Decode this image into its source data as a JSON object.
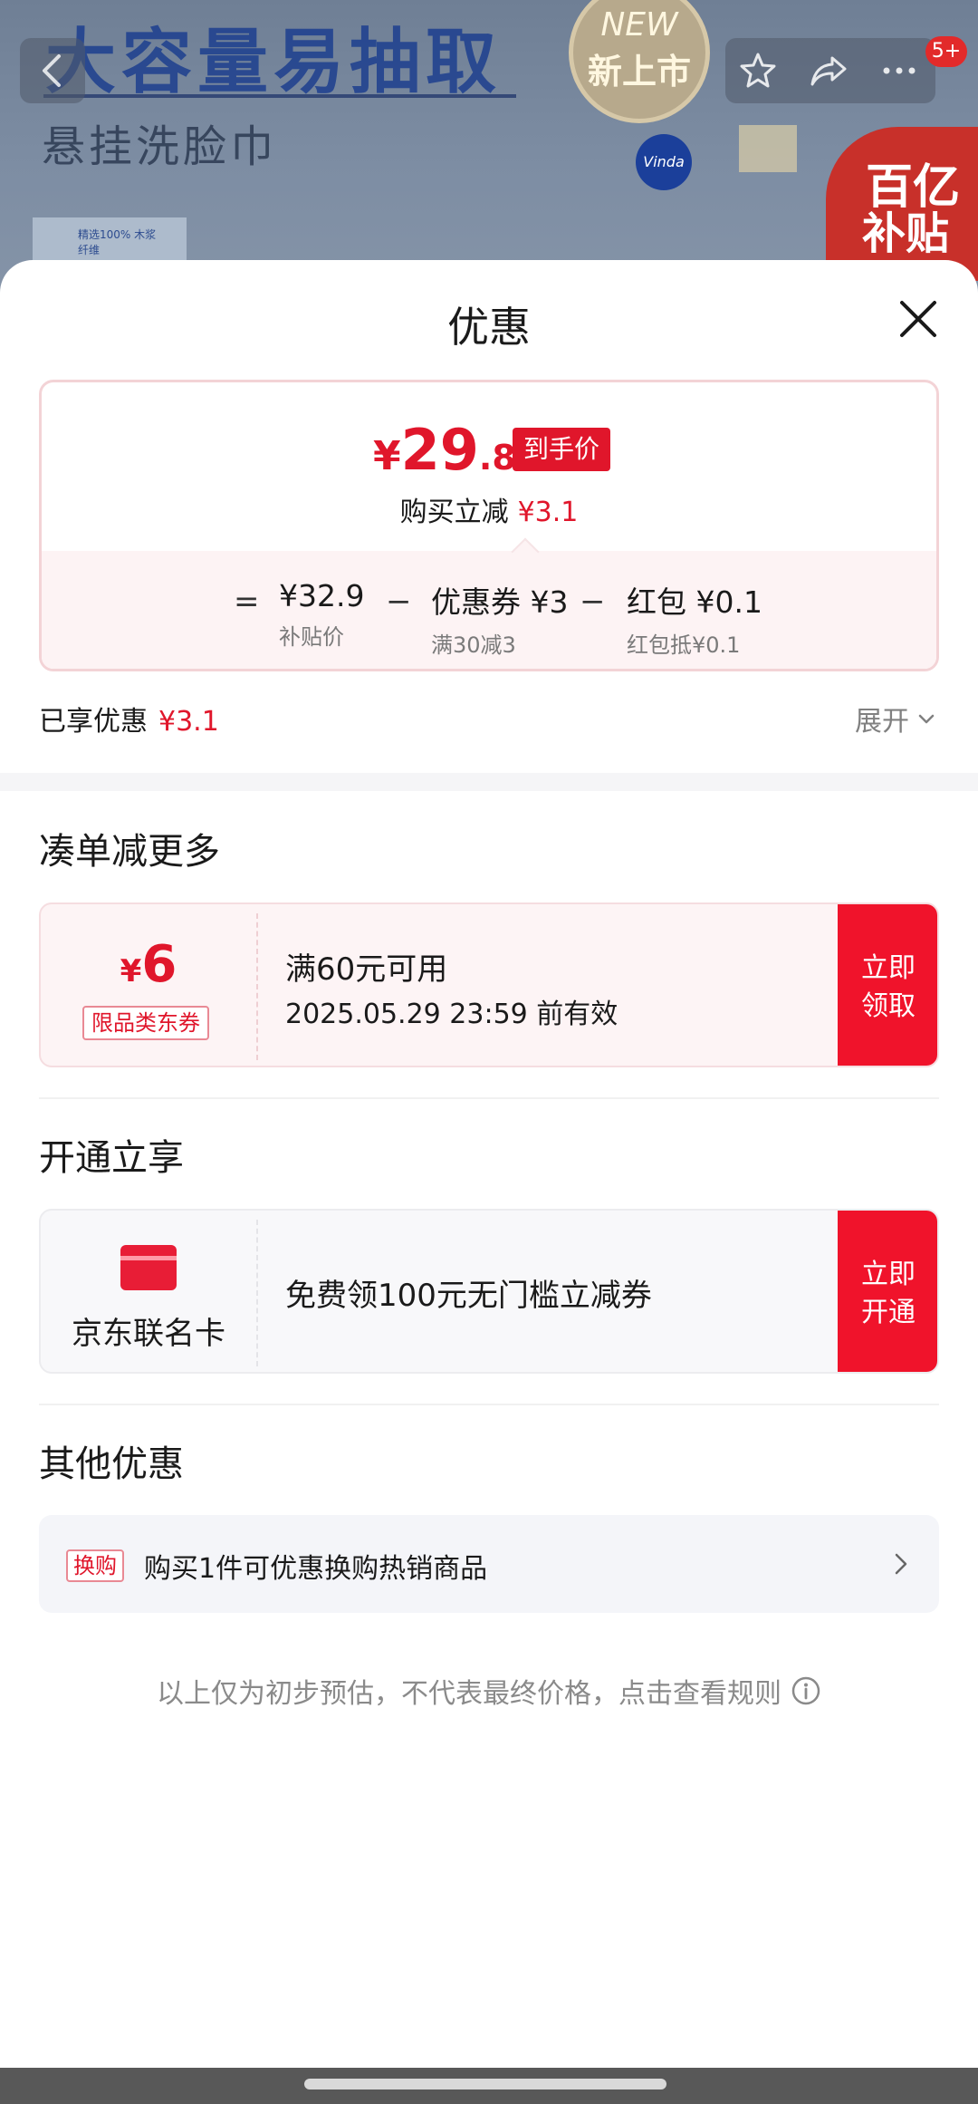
{
  "banner": {
    "headline": "大容量易抽取",
    "subheadline": "悬挂洗脸巾",
    "new_badge_en": "NEW",
    "new_badge_cn": "新上市",
    "brand": "Vinda",
    "subsidy_line1": "百亿",
    "subsidy_line2": "补贴",
    "box_text": "精选100% 木浆纤维"
  },
  "nav": {
    "back_icon": "chevron-left-icon",
    "favorite_icon": "star-icon",
    "share_icon": "share-icon",
    "more_icon": "more-icon",
    "message_badge": "5+"
  },
  "sheet": {
    "title": "优惠",
    "close_icon": "close-icon"
  },
  "price_card": {
    "currency": "¥",
    "final_int": "29",
    "final_dec": ".8",
    "final_tag": "到手价",
    "instant_label": "购买立减",
    "instant_amount": "¥3.1",
    "formula": {
      "equals": "=",
      "minus": "−",
      "items": [
        {
          "value": "¥32.9",
          "label": "补贴价"
        },
        {
          "value": "优惠券 ¥3",
          "label": "满30减3"
        },
        {
          "value": "红包 ¥0.1",
          "label": "红包抵¥0.1"
        }
      ]
    }
  },
  "enjoyed": {
    "label": "已享优惠",
    "amount": "¥3.1",
    "expand_label": "展开"
  },
  "more_discount": {
    "title": "凑单减更多",
    "coupon": {
      "currency": "¥",
      "amount": "6",
      "type": "限品类东券",
      "condition": "满60元可用",
      "validity": "2025.05.29 23:59 前有效",
      "button_line1": "立即",
      "button_line2": "领取"
    }
  },
  "open_enjoy": {
    "title": "开通立享",
    "card_name": "京东联名卡",
    "card_desc": "免费领100元无门槛立减券",
    "button_line1": "立即",
    "button_line2": "开通"
  },
  "other": {
    "title": "其他优惠",
    "tag": "换购",
    "text": "购买1件可优惠换购热销商品"
  },
  "disclaimer": "以上仅为初步预估，不代表最终价格，点击查看规则",
  "colors": {
    "accent_red": "#e0162b",
    "button_red": "#f0132b"
  }
}
